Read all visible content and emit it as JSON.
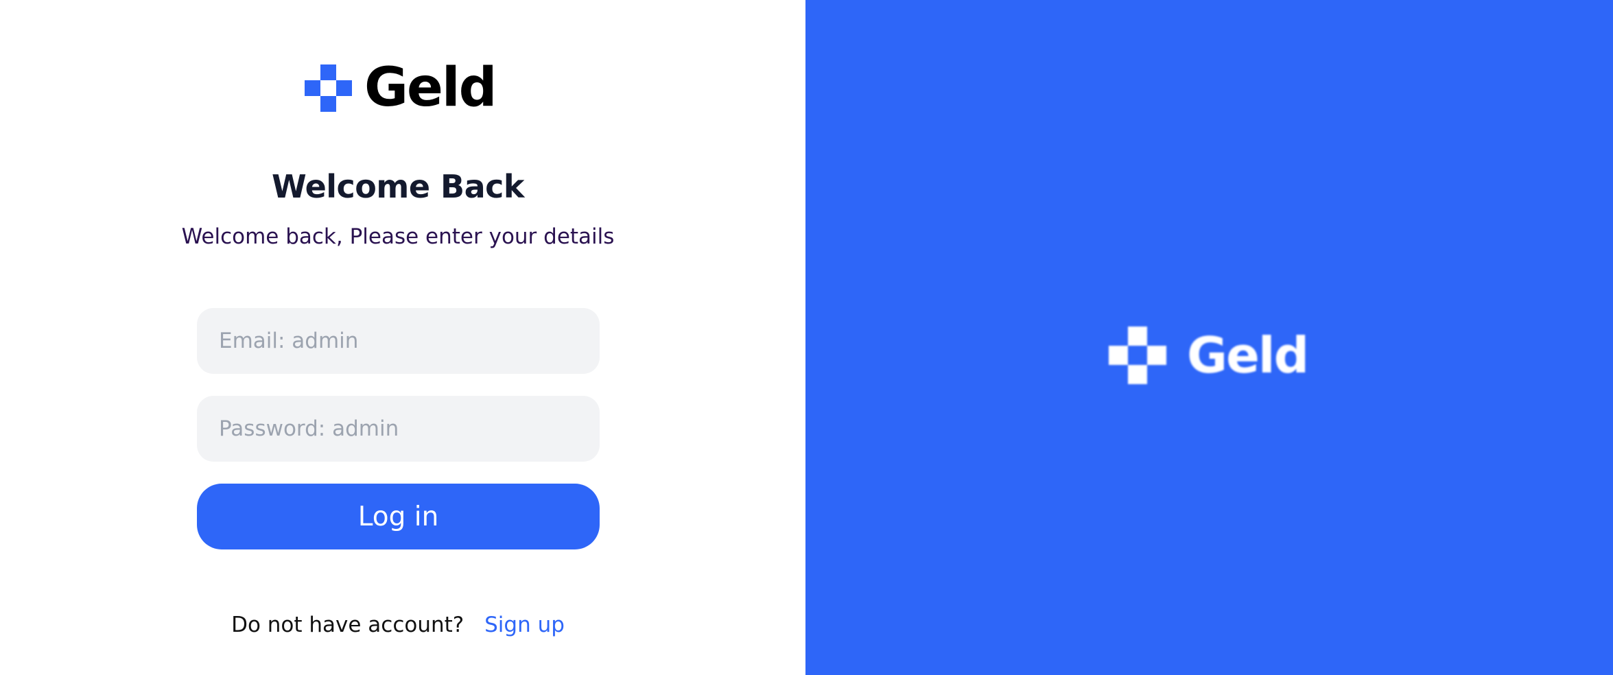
{
  "colors": {
    "brand_blue": "#2e66f8",
    "logo_text_dark": "#000000",
    "logo_text_light": "#ffffff",
    "field_bg": "#f2f3f5",
    "placeholder": "#9ca3af"
  },
  "login": {
    "logo": {
      "icon": "cross-squares-logo-icon",
      "text": "Geld"
    },
    "title": "Welcome Back",
    "subtitle": "Welcome back, Please enter your details",
    "email_placeholder": "Email: admin",
    "password_placeholder": "Password: admin",
    "login_button": "Log in",
    "signup_prompt": "Do not have account?",
    "signup_link": "Sign up"
  },
  "hero": {
    "logo": {
      "icon": "cross-squares-logo-icon",
      "text": "Geld"
    }
  }
}
